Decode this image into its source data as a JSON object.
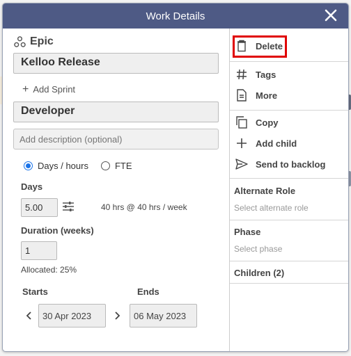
{
  "dialog": {
    "title": "Work Details"
  },
  "left": {
    "type_label": "Epic",
    "release_name": "Kelloo Release",
    "add_sprint_label": "Add Sprint",
    "role_name": "Developer",
    "description_placeholder": "Add description (optional)",
    "mode_options": [
      {
        "label": "Days / hours",
        "selected": true
      },
      {
        "label": "FTE",
        "selected": false
      }
    ],
    "days_label": "Days",
    "days_value": "5.00",
    "hours_text": "40 hrs @ 40 hrs / week",
    "duration_label": "Duration (weeks)",
    "duration_value": "1",
    "allocated_text": "Allocated: 25%",
    "starts_label": "Starts",
    "ends_label": "Ends",
    "start_date": "30 Apr 2023",
    "end_date": "06 May 2023"
  },
  "right": {
    "menu": {
      "delete": "Delete",
      "tags": "Tags",
      "more": "More",
      "copy": "Copy",
      "add_child": "Add child",
      "send_to_backlog": "Send to backlog"
    },
    "alternate_role_title": "Alternate Role",
    "alternate_role_placeholder": "Select alternate role",
    "phase_title": "Phase",
    "phase_placeholder": "Select phase",
    "children_title": "Children (2)"
  },
  "colors": {
    "title_bar": "#4e5a85",
    "highlight": "#e00000",
    "radio_accent": "#1a73e8"
  }
}
